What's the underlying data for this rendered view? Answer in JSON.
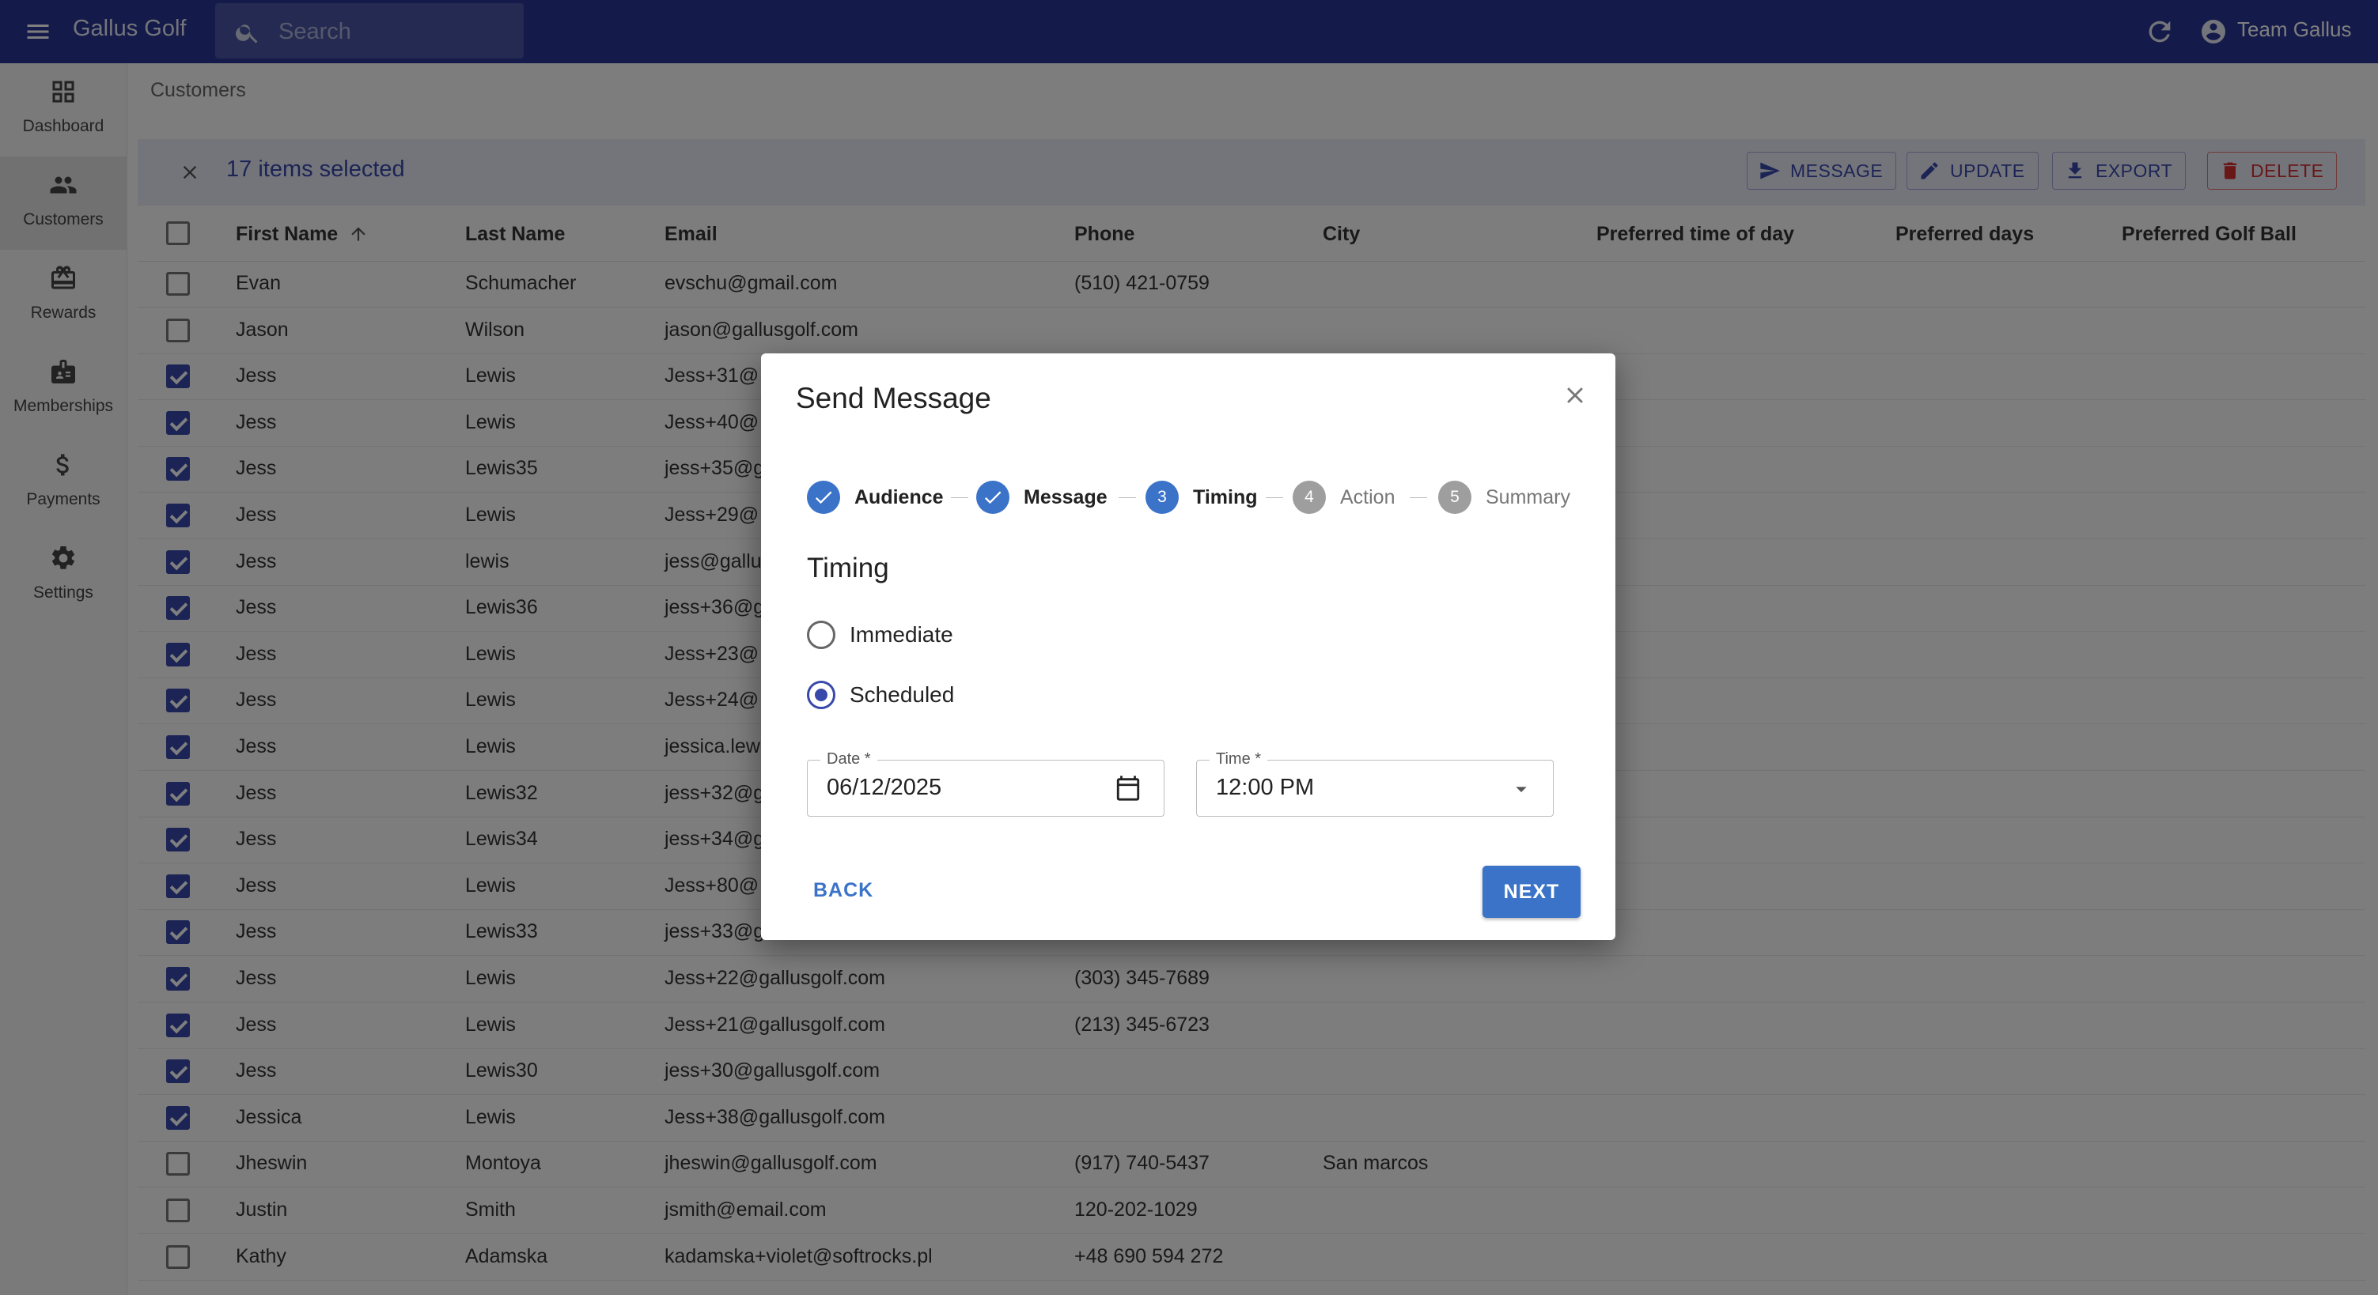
{
  "app": {
    "title": "Gallus Golf",
    "search_placeholder": "Search",
    "account_name": "Team Gallus"
  },
  "nav": [
    {
      "label": "Dashboard",
      "icon": "dashboard-icon"
    },
    {
      "label": "Customers",
      "icon": "people-icon",
      "active": true
    },
    {
      "label": "Rewards",
      "icon": "gift-card-icon"
    },
    {
      "label": "Memberships",
      "icon": "badge-icon"
    },
    {
      "label": "Payments",
      "icon": "dollar-icon"
    },
    {
      "label": "Settings",
      "icon": "gear-icon"
    }
  ],
  "breadcrumb": "Customers",
  "selection": {
    "count_text": "17 items selected",
    "actions": {
      "message": "MESSAGE",
      "update": "UPDATE",
      "export": "EXPORT",
      "delete": "DELETE"
    }
  },
  "table": {
    "headers": {
      "first": "First Name",
      "last": "Last Name",
      "email": "Email",
      "phone": "Phone",
      "city": "City",
      "time": "Preferred time of day",
      "days": "Preferred days",
      "ball": "Preferred Golf Ball"
    },
    "rows": [
      {
        "checked": false,
        "first": "Evan",
        "last": "Schumacher",
        "email": "evschu@gmail.com",
        "phone": "(510) 421-0759",
        "city": ""
      },
      {
        "checked": false,
        "first": "Jason",
        "last": "Wilson",
        "email": "jason@gallusgolf.com",
        "phone": "",
        "city": ""
      },
      {
        "checked": true,
        "first": "Jess",
        "last": "Lewis",
        "email": "Jess+31@",
        "phone": "",
        "city": ""
      },
      {
        "checked": true,
        "first": "Jess",
        "last": "Lewis",
        "email": "Jess+40@",
        "phone": "",
        "city": ""
      },
      {
        "checked": true,
        "first": "Jess",
        "last": "Lewis35",
        "email": "jess+35@g",
        "phone": "",
        "city": ""
      },
      {
        "checked": true,
        "first": "Jess",
        "last": "Lewis",
        "email": "Jess+29@",
        "phone": "",
        "city": ""
      },
      {
        "checked": true,
        "first": "Jess",
        "last": "lewis",
        "email": "jess@gallu",
        "phone": "",
        "city": ""
      },
      {
        "checked": true,
        "first": "Jess",
        "last": "Lewis36",
        "email": "jess+36@g",
        "phone": "",
        "city": ""
      },
      {
        "checked": true,
        "first": "Jess",
        "last": "Lewis",
        "email": "Jess+23@",
        "phone": "",
        "city": ""
      },
      {
        "checked": true,
        "first": "Jess",
        "last": "Lewis",
        "email": "Jess+24@",
        "phone": "",
        "city": ""
      },
      {
        "checked": true,
        "first": "Jess",
        "last": "Lewis",
        "email": "jessica.lew",
        "phone": "",
        "city": ""
      },
      {
        "checked": true,
        "first": "Jess",
        "last": "Lewis32",
        "email": "jess+32@g",
        "phone": "",
        "city": ""
      },
      {
        "checked": true,
        "first": "Jess",
        "last": "Lewis34",
        "email": "jess+34@g",
        "phone": "",
        "city": ""
      },
      {
        "checked": true,
        "first": "Jess",
        "last": "Lewis",
        "email": "Jess+80@",
        "phone": "",
        "city": ""
      },
      {
        "checked": true,
        "first": "Jess",
        "last": "Lewis33",
        "email": "jess+33@g",
        "phone": "",
        "city": ""
      },
      {
        "checked": true,
        "first": "Jess",
        "last": "Lewis",
        "email": "Jess+22@gallusgolf.com",
        "phone": "(303) 345-7689",
        "city": ""
      },
      {
        "checked": true,
        "first": "Jess",
        "last": "Lewis",
        "email": "Jess+21@gallusgolf.com",
        "phone": "(213) 345-6723",
        "city": ""
      },
      {
        "checked": true,
        "first": "Jess",
        "last": "Lewis30",
        "email": "jess+30@gallusgolf.com",
        "phone": "",
        "city": ""
      },
      {
        "checked": true,
        "first": "Jessica",
        "last": "Lewis",
        "email": "Jess+38@gallusgolf.com",
        "phone": "",
        "city": ""
      },
      {
        "checked": false,
        "first": "Jheswin",
        "last": "Montoya",
        "email": "jheswin@gallusgolf.com",
        "phone": "(917) 740-5437",
        "city": "San marcos"
      },
      {
        "checked": false,
        "first": "Justin",
        "last": "Smith",
        "email": "jsmith@email.com",
        "phone": "120-202-1029",
        "city": ""
      },
      {
        "checked": false,
        "first": "Kathy",
        "last": "Adamska",
        "email": "kadamska+violet@softrocks.pl",
        "phone": "+48 690 594 272",
        "city": ""
      }
    ]
  },
  "dialog": {
    "title": "Send Message",
    "steps": [
      {
        "label": "Audience",
        "state": "done",
        "number": ""
      },
      {
        "label": "Message",
        "state": "done",
        "number": ""
      },
      {
        "label": "Timing",
        "state": "active",
        "number": "3"
      },
      {
        "label": "Action",
        "state": "pending",
        "number": "4"
      },
      {
        "label": "Summary",
        "state": "pending",
        "number": "5"
      }
    ],
    "section_title": "Timing",
    "options": [
      {
        "label": "Immediate",
        "selected": false
      },
      {
        "label": "Scheduled",
        "selected": true
      }
    ],
    "date": {
      "label": "Date *",
      "value": "06/12/2025"
    },
    "time": {
      "label": "Time *",
      "value": "12:00 PM"
    },
    "back_label": "BACK",
    "next_label": "NEXT"
  }
}
